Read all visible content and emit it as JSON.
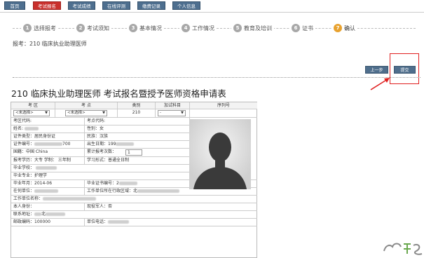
{
  "nav": {
    "tabs": [
      {
        "label": "首页"
      },
      {
        "label": "考试报名"
      },
      {
        "label": "考试成绩"
      },
      {
        "label": "在线评测"
      },
      {
        "label": "缴费记录"
      },
      {
        "label": "个人信息"
      }
    ]
  },
  "steps": [
    {
      "num": "1",
      "label": "选择报考"
    },
    {
      "num": "2",
      "label": "考试须知"
    },
    {
      "num": "3",
      "label": "基本情况"
    },
    {
      "num": "4",
      "label": "工作情况"
    },
    {
      "num": "5",
      "label": "教育及培训"
    },
    {
      "num": "6",
      "label": "证书"
    },
    {
      "num": "7",
      "label": "确认"
    }
  ],
  "apply_line": "报考：210 临床执业助理医师",
  "buttons": {
    "prev": "上一步",
    "submit": "提交"
  },
  "form_title": "210 临床执业助理医师 考试报名暨授予医师资格申请表",
  "table": {
    "headers": [
      "考 区",
      "考 点",
      "类别",
      "加试科目",
      "序列号"
    ],
    "selects": [
      "<未选择>",
      "<未选择>",
      "-"
    ],
    "category_value": "210",
    "rows": [
      {
        "left": "考区代码:",
        "right": "考点代码:"
      },
      {
        "left": "姓名:",
        "right": "性别：女"
      },
      {
        "left": "证件类型：居民身份证",
        "right": "民族：汉族"
      },
      {
        "left": "证件编号：",
        "left_tail": "700",
        "right": "出生日期：",
        "right_tail": "199"
      },
      {
        "left": "国籍：中国 China",
        "right": "累计报考次数：",
        "right_input": "1"
      },
      {
        "left": "报考学历：大专   学制：  三年制",
        "right": "学习形式：普通全日制"
      },
      {
        "left": "毕业学校："
      },
      {
        "left": "毕业专业：护理学"
      },
      {
        "left": "毕业年月：2014-06",
        "right": "毕业证书编号：",
        "right_tail": "2"
      },
      {
        "left": "在何单位：",
        "right": "工作单位所在行政区域：",
        "right_tail": "北"
      },
      {
        "left": "工作单位名称："
      },
      {
        "left": "本人身份：",
        "right": "现役军人：否"
      },
      {
        "left": "联系地址：",
        "left_tail": "北"
      },
      {
        "left": "邮政编码：",
        "left_tail": "100000",
        "right": "单位电话："
      }
    ]
  },
  "colors": {
    "nav_tab": "#4e6f8f",
    "nav_active": "#c9302c",
    "step_active": "#e8a22f",
    "highlight": "#e02020"
  }
}
